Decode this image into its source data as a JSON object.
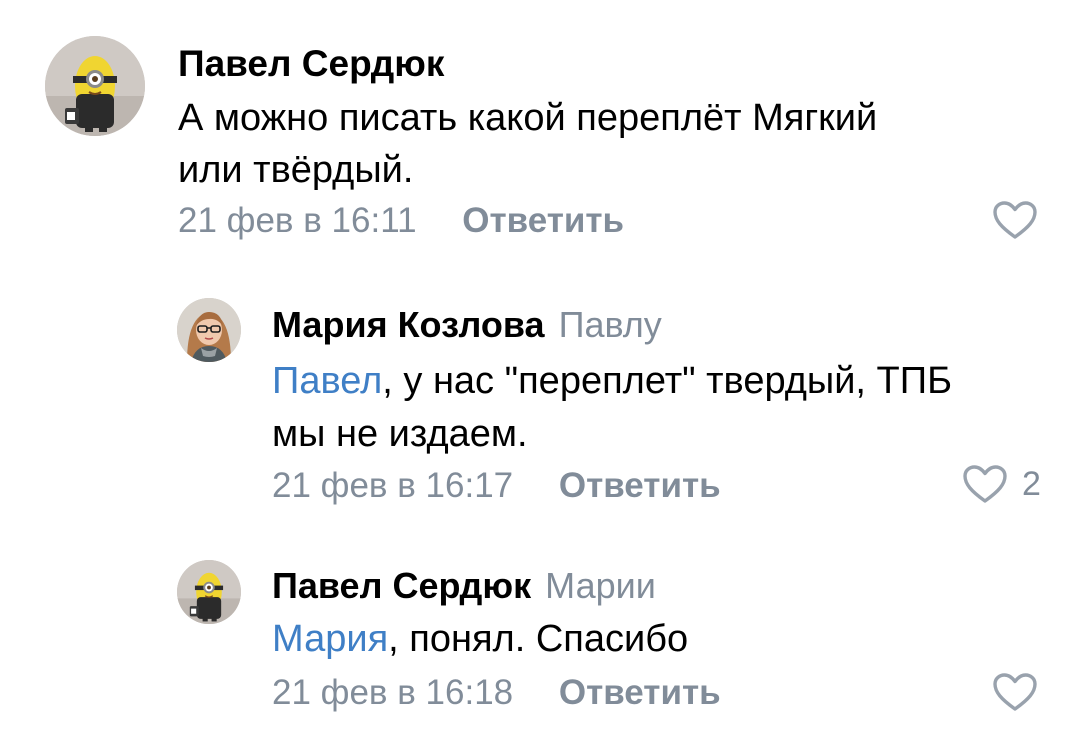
{
  "comments": [
    {
      "author": "Павел Сердюк",
      "reply_to": "",
      "mention": "",
      "text_lines": [
        "А можно писать какой переплёт Мягкий",
        "или твёрдый."
      ],
      "date": "21 фев в 16:11",
      "reply_label": "Ответить",
      "likes": "",
      "avatar_icon": "minion-avatar-icon"
    },
    {
      "author": "Мария Козлова",
      "reply_to": "Павлу",
      "mention": "Павел",
      "text_lines": [
        ", у нас \"переплет\" твердый, ТПБ",
        "мы не издаем."
      ],
      "date": "21 фев в 16:17",
      "reply_label": "Ответить",
      "likes": "2",
      "avatar_icon": "woman-glasses-avatar-icon"
    },
    {
      "author": "Павел Сердюк",
      "reply_to": "Марии",
      "mention": "Мария",
      "text_lines": [
        ", понял. Спасибо"
      ],
      "date": "21 фев в 16:18",
      "reply_label": "Ответить",
      "likes": "",
      "avatar_icon": "minion-avatar-icon"
    }
  ],
  "colors": {
    "text": "#000000",
    "secondary": "#818c99",
    "mention": "#3f7fc6",
    "icon": "#99a2ad"
  }
}
